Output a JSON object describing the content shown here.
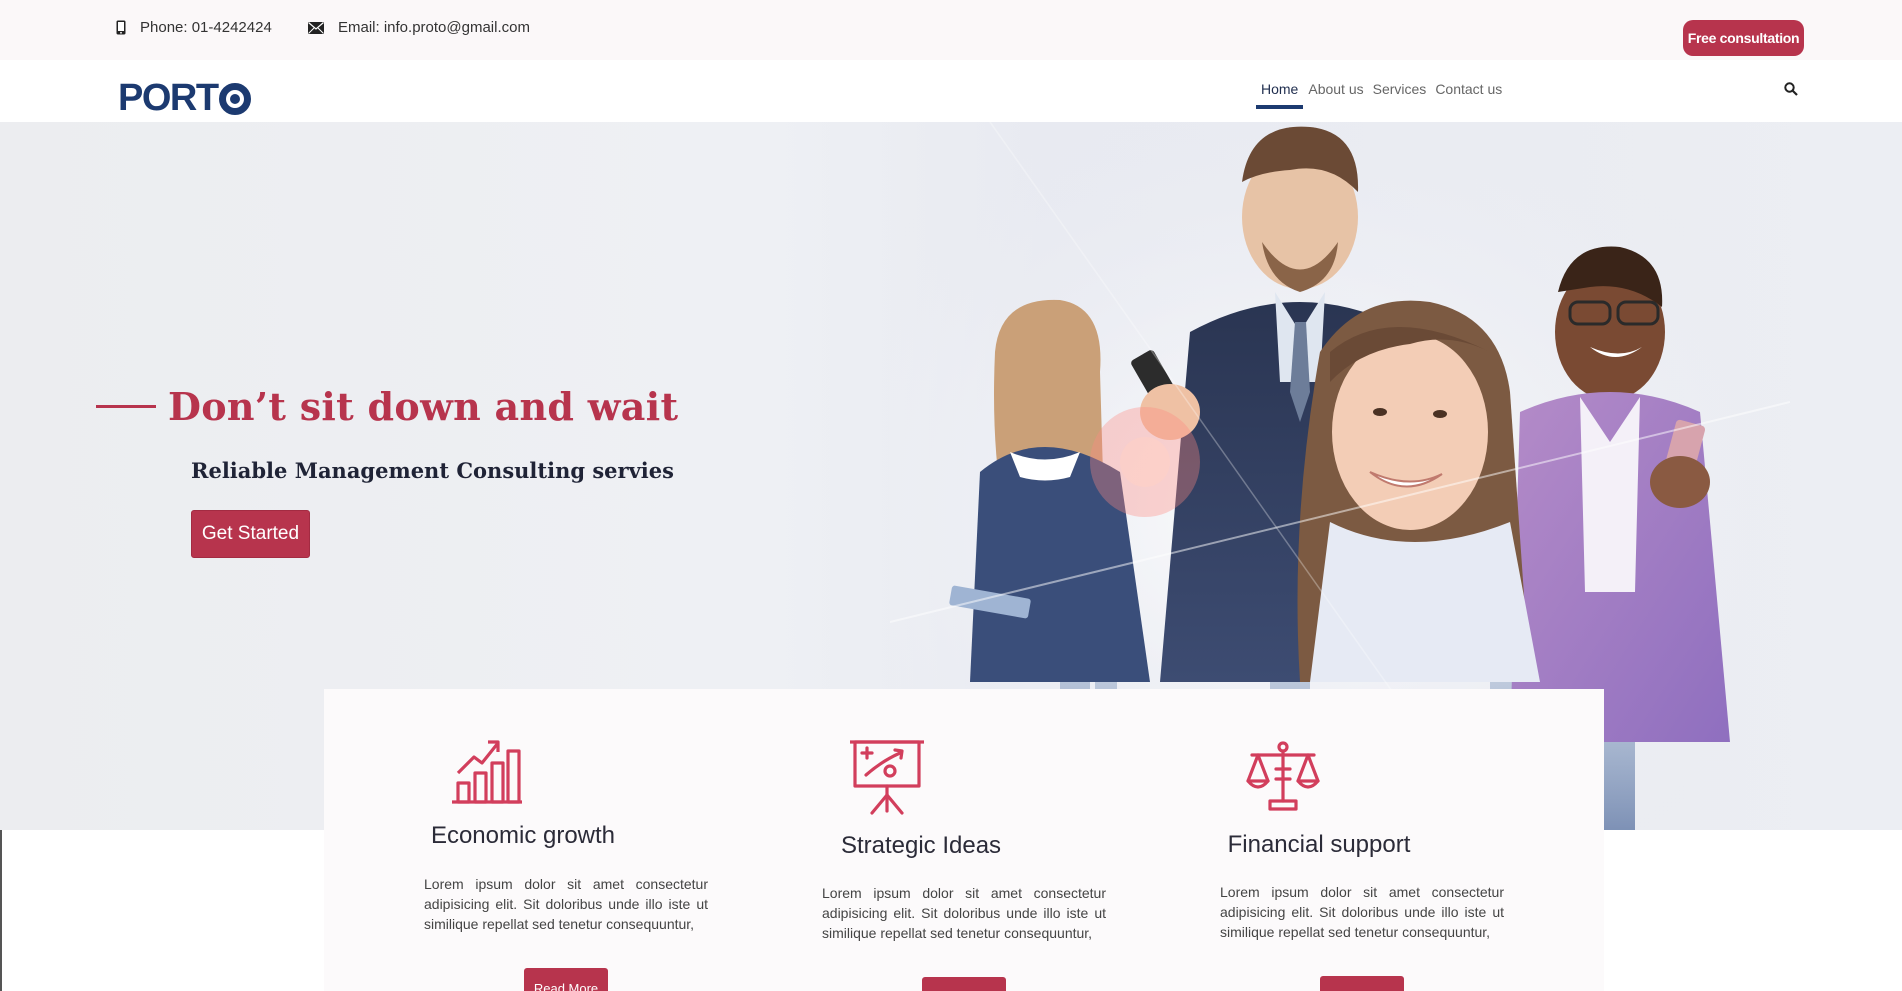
{
  "topbar": {
    "phone": "Phone: 01-4242424",
    "email": "Email: info.proto@gmail.com",
    "consult_button": "Free consultation",
    "phone_icon": "mobile-phone-icon",
    "email_icon": "envelope-icon"
  },
  "navbar": {
    "logo_text": "PORT",
    "items": [
      {
        "label": "Home",
        "active": true
      },
      {
        "label": "About us",
        "active": false
      },
      {
        "label": "Services",
        "active": false
      },
      {
        "label": "Contact us",
        "active": false
      }
    ],
    "search_icon": "search-icon"
  },
  "hero": {
    "tagline": "Don’t sit down and wait",
    "subtitle": "Reliable Management Consulting servies",
    "cta": "Get Started"
  },
  "cards": [
    {
      "icon": "growth-chart-icon",
      "title": "Economic growth",
      "text": "Lorem ipsum dolor sit amet consectetur adipisicing elit. Sit doloribus unde illo iste ut similique repellat sed tenetur consequuntur,",
      "button": "Read More"
    },
    {
      "icon": "presentation-board-icon",
      "title": "Strategic Ideas",
      "text": "Lorem ipsum dolor sit amet consectetur adipisicing elit. Sit doloribus unde illo iste ut similique repellat sed tenetur consequuntur,",
      "button": ""
    },
    {
      "icon": "balance-scale-icon",
      "title": "Financial support",
      "text": "Lorem ipsum dolor sit amet consectetur adipisicing elit. Sit doloribus unde illo iste ut similique repellat sed tenetur consequuntur,",
      "button": ""
    }
  ],
  "colors": {
    "accent": "#b7344d",
    "brand": "#1c3a70"
  }
}
